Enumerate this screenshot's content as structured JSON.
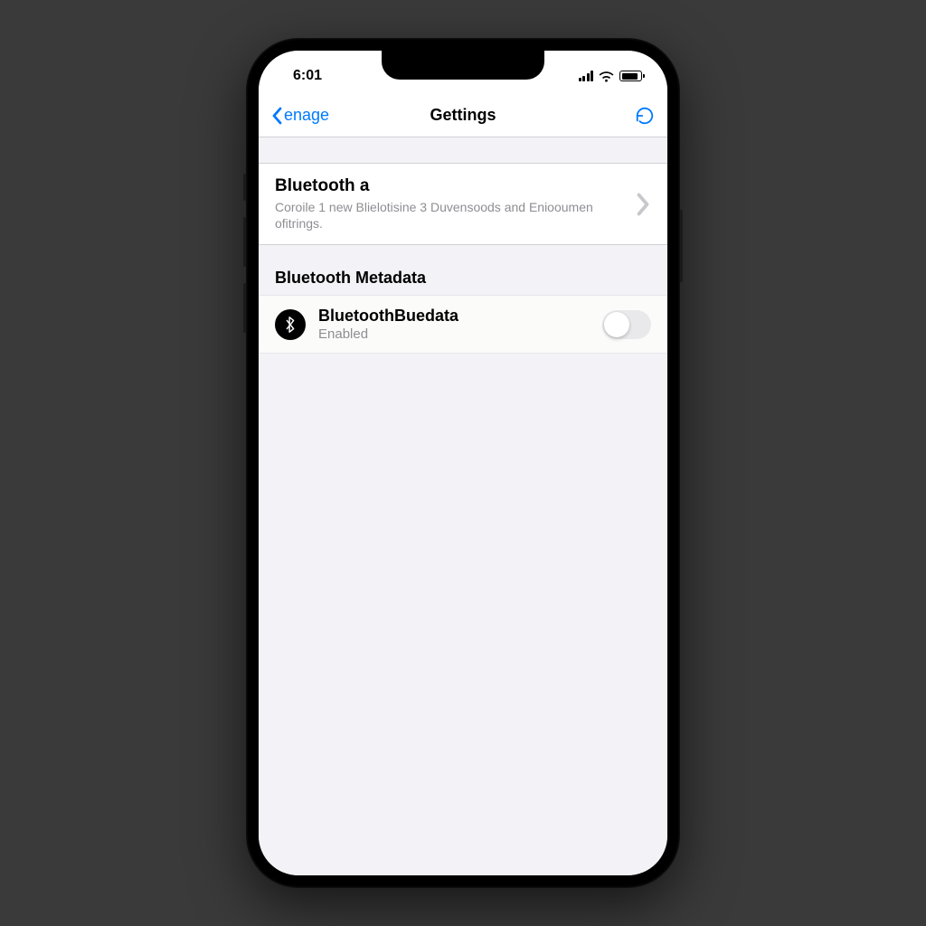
{
  "status": {
    "time": "6:01"
  },
  "nav": {
    "back_label": "enage",
    "title": "Gettings"
  },
  "bluetooth": {
    "title": "Bluetooth a",
    "description": "Coroile 1 new Blielotisine 3 Duvensoods and Eniooumen ofitrings."
  },
  "metadata_section": {
    "header": "Bluetooth Metadata",
    "row": {
      "title": "BluetoothBuedata",
      "status": "Enabled"
    }
  },
  "icons": {
    "bluetooth": "bluetooth-icon",
    "refresh": "refresh-icon",
    "chevron_left": "chevron-left-icon",
    "disclosure": "chevron-right-icon"
  }
}
